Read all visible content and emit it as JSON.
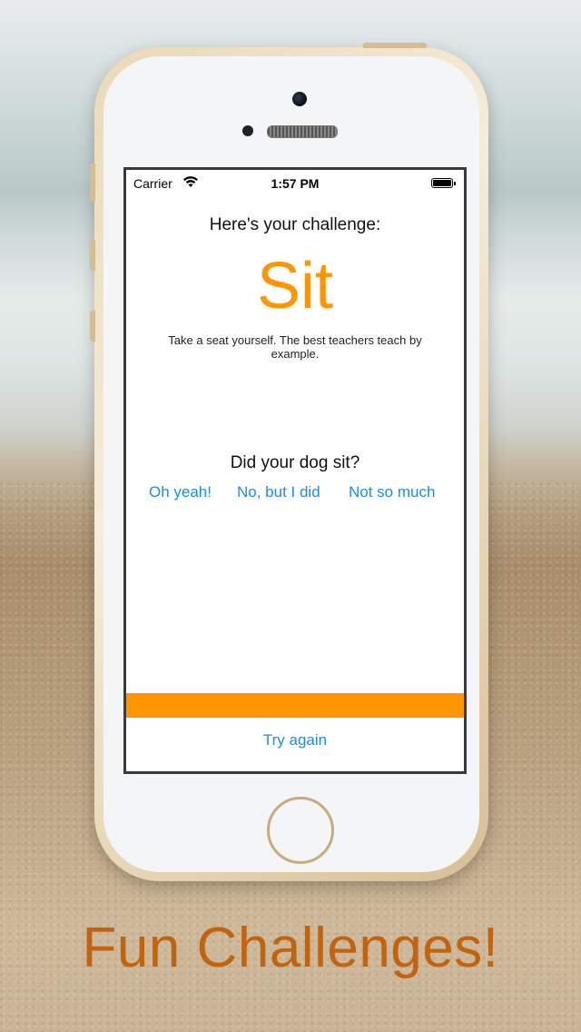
{
  "status_bar": {
    "carrier": "Carrier",
    "wifi_icon": "wifi-icon",
    "time": "1:57 PM",
    "battery_icon": "battery-icon"
  },
  "challenge": {
    "heading": "Here's your challenge:",
    "name": "Sit",
    "description": "Take a seat yourself. The best teachers teach by example."
  },
  "question": {
    "text": "Did your dog sit?",
    "answers": [
      "Oh yeah!",
      "No, but I did",
      "Not so much"
    ]
  },
  "progress": {
    "value": 1.0,
    "color": "#ff9500"
  },
  "actions": {
    "try_again": "Try again"
  },
  "marketing": {
    "caption": "Fun Challenges!",
    "caption_color": "#c0640f"
  },
  "colors": {
    "accent": "#ff9500",
    "link": "#1a8cf0"
  }
}
